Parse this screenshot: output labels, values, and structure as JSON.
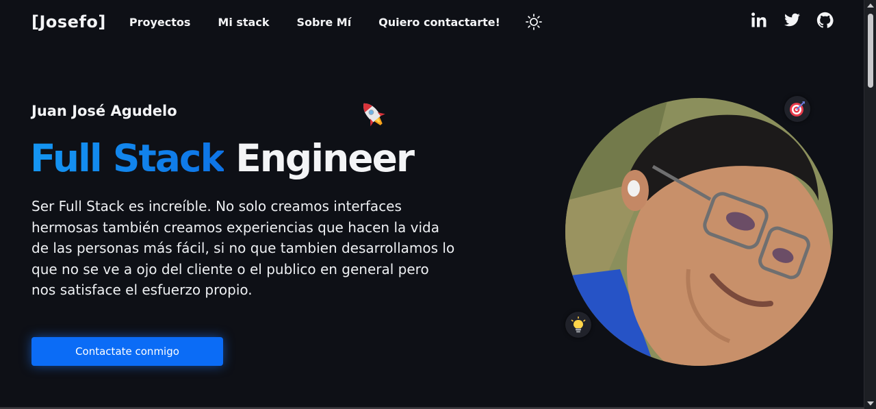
{
  "nav": {
    "logo": "[Josefo]",
    "links": [
      "Proyectos",
      "Mi stack",
      "Sobre Mí",
      "Quiero contactarte!"
    ]
  },
  "social": {
    "icons": [
      "linkedin-icon",
      "twitter-icon",
      "github-icon"
    ],
    "linkedin_label": "in"
  },
  "hero": {
    "name": "Juan José Agudelo",
    "title_accent": "Full Stack",
    "title_rest": "Engineer",
    "description": "Ser Full Stack es increíble. No solo creamos interfaces hermosas también creamos experiencias que hacen la vida de las personas más fácil, si no que tambien desarrollamos lo que no se ve a ojo del cliente o el publico en general pero nos satisface el esfuerzo propio.",
    "cta_label": "Contactate conmigo",
    "decorations": [
      "rocket-emoji",
      "target-emoji",
      "lightbulb-emoji"
    ]
  },
  "colors": {
    "background": "#0e1016",
    "accent": "#0e74e6",
    "button": "#0b6cf6",
    "text": "#f3f4f6"
  }
}
